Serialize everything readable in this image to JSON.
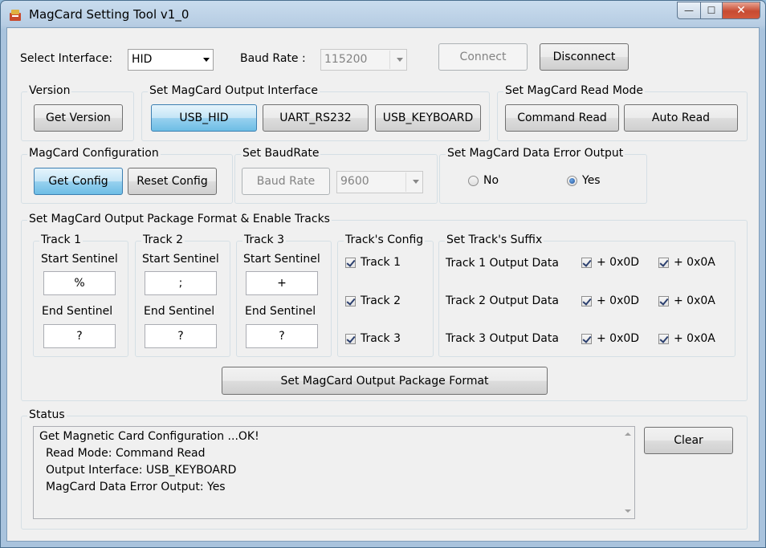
{
  "window": {
    "title": "MagCard Setting Tool v1_0",
    "controls": {
      "minimize": "—",
      "maximize": "☐",
      "close": "✕"
    }
  },
  "top": {
    "interface_label": "Select Interface:",
    "interface_value": "HID",
    "baud_label": "Baud Rate :",
    "baud_value": "115200",
    "connect": "Connect",
    "disconnect": "Disconnect"
  },
  "version": {
    "title": "Version",
    "get_version": "Get Version"
  },
  "output_interface": {
    "title": "Set MagCard Output Interface",
    "usb_hid": "USB_HID",
    "uart": "UART_RS232",
    "usb_keyboard": "USB_KEYBOARD"
  },
  "read_mode": {
    "title": "Set MagCard Read Mode",
    "command_read": "Command Read",
    "auto_read": "Auto Read"
  },
  "configuration": {
    "title": "MagCard Configuration",
    "get_config": "Get Config",
    "reset_config": "Reset Config"
  },
  "baudrate": {
    "title": "Set BaudRate",
    "baud_button": "Baud Rate",
    "value": "9600"
  },
  "error_output": {
    "title": "Set MagCard Data Error Output",
    "no": "No",
    "yes": "Yes",
    "selected": "Yes"
  },
  "package": {
    "title": "Set MagCard Output Package Format & Enable Tracks",
    "start_label": "Start Sentinel",
    "end_label": "End Sentinel",
    "tracks": [
      {
        "title": "Track 1",
        "start": "%",
        "end": "?"
      },
      {
        "title": "Track 2",
        "start": ";",
        "end": "?"
      },
      {
        "title": "Track 3",
        "start": "+",
        "end": "?"
      }
    ],
    "config_title": "Track's Config",
    "config_items": [
      "Track 1",
      "Track 2",
      "Track 3"
    ],
    "suffix_title": "Set Track's Suffix",
    "suffix_rows": [
      {
        "label": "Track 1 Output Data",
        "cr": "+ 0x0D",
        "lf": "+ 0x0A"
      },
      {
        "label": "Track 2 Output Data",
        "cr": "+ 0x0D",
        "lf": "+ 0x0A"
      },
      {
        "label": "Track 3 Output Data",
        "cr": "+ 0x0D",
        "lf": "+ 0x0A"
      }
    ],
    "set_button": "Set MagCard Output Package Format"
  },
  "status": {
    "title": "Status",
    "lines": [
      "Get Magnetic Card Configuration ...OK!",
      "Read Mode: Command Read",
      "Output Interface: USB_KEYBOARD",
      "MagCard Data Error Output: Yes"
    ],
    "clear": "Clear"
  }
}
